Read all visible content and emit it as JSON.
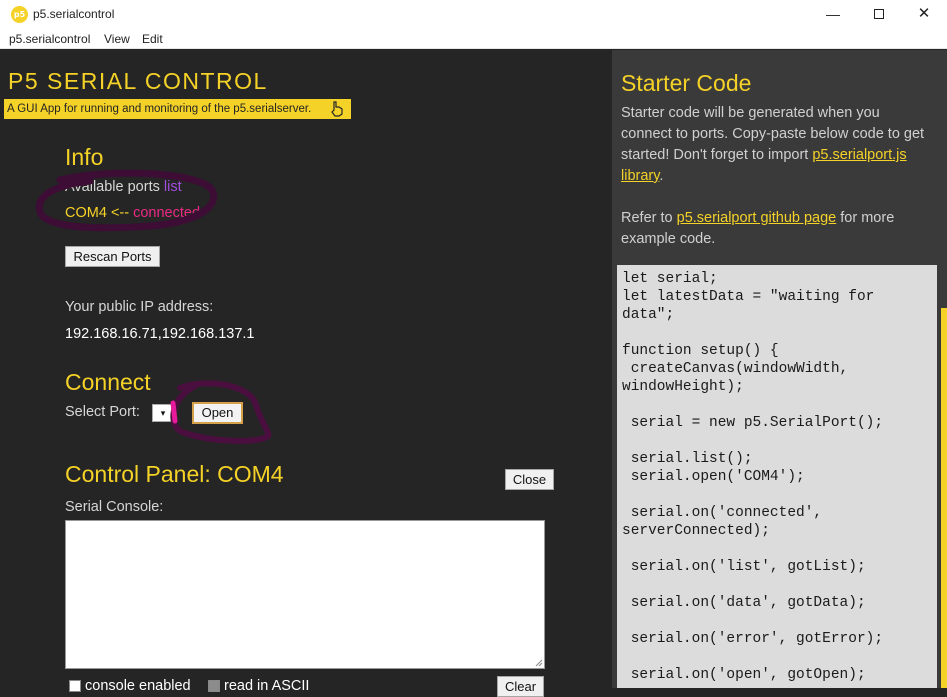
{
  "window": {
    "icon_text": "p5",
    "title": "p5.serialcontrol",
    "minimize": "—",
    "close": "✕"
  },
  "menu": {
    "items": [
      "p5.serialcontrol",
      "View",
      "Edit"
    ]
  },
  "header": {
    "title": "P5 SERIAL CONTROL",
    "subtitle": "A GUI App for running and monitoring of the p5.serialserver."
  },
  "info": {
    "heading": "Info",
    "available_label": "Available ports",
    "list_link": "list",
    "port_name": "COM4",
    "port_arrow": "<--",
    "port_status": "connected",
    "rescan_label": "Rescan Ports",
    "ip_label": "Your public IP address:",
    "ip_value": "192.168.16.71,192.168.137.1"
  },
  "connect": {
    "heading": "Connect",
    "select_label": "Select Port:",
    "select_value": "▾",
    "open_label": "Open"
  },
  "control_panel": {
    "heading": "Control Panel: COM4",
    "close_label": "Close",
    "console_label": "Serial Console:",
    "console_value": "",
    "console_enabled_label": "console enabled",
    "read_ascii_label": "read in ASCII",
    "clear_label": "Clear"
  },
  "starter": {
    "heading": "Starter Code",
    "intro": "Starter code will be generated when you connect to ports. Copy-paste below code to get started! Don't forget to import",
    "library_link": "p5.serialport.js library",
    "intro_end": ".",
    "refer_prefix": "Refer to",
    "github_link": "p5.serialport github page",
    "refer_suffix": "for more example code.",
    "code": "let serial;\nlet latestData = \"waiting for data\";\n\nfunction setup() {\n createCanvas(windowWidth, windowHeight);\n\n serial = new p5.SerialPort();\n\n serial.list();\n serial.open('COM4');\n\n serial.on('connected', serverConnected);\n\n serial.on('list', gotList);\n\n serial.on('data', gotData);\n\n serial.on('error', gotError);\n\n serial.on('open', gotOpen);"
  },
  "colors": {
    "accent": "#f5d227",
    "background": "#252525",
    "sidebar": "#3a3a3a",
    "connected": "#ec2a86",
    "list_link": "#a24ce0",
    "annotation_circle": "#4a0f3f"
  }
}
